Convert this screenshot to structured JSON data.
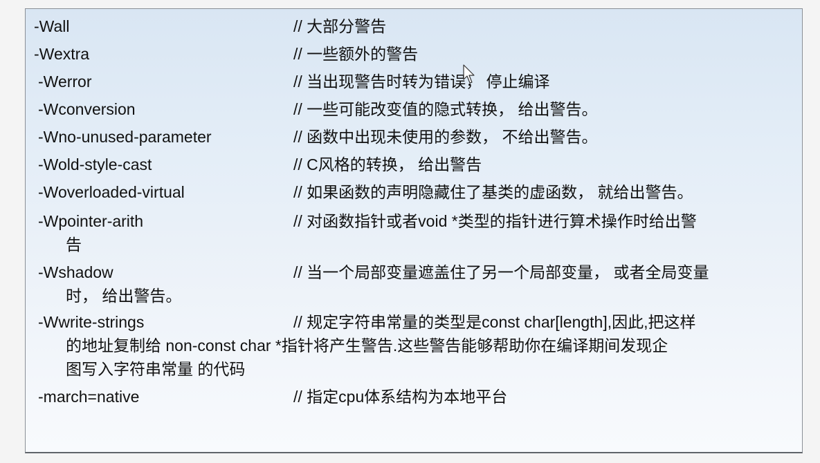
{
  "entries": [
    {
      "flag": "-Wall",
      "desc": "// 大部分警告"
    },
    {
      "flag": "-Wextra",
      "desc": "// 一些额外的警告"
    },
    {
      "flag": "-Werror",
      "desc": "// 当出现警告时转为错误， 停止编译"
    },
    {
      "flag": "-Wconversion",
      "desc": "// 一些可能改变值的隐式转换， 给出警告。"
    },
    {
      "flag": "-Wno-unused-parameter",
      "desc": "// 函数中出现未使用的参数， 不给出警告。"
    },
    {
      "flag": "-Wold-style-cast",
      "desc": "// C风格的转换， 给出警告"
    },
    {
      "flag": "-Woverloaded-virtual",
      "desc": "// 如果函数的声明隐藏住了基类的虚函数， 就给出警告。"
    },
    {
      "flag": "-Wpointer-arith",
      "desc": "// 对函数指针或者void *类型的指针进行算术操作时给出警",
      "cont": "告"
    },
    {
      "flag": "-Wshadow",
      "desc": "// 当一个局部变量遮盖住了另一个局部变量， 或者全局变量",
      "cont": "时， 给出警告。"
    },
    {
      "flag": "-Wwrite-strings",
      "desc": "// 规定字符串常量的类型是const char[length],因此,把这样",
      "cont": "的地址复制给 non-const char *指针将产生警告.这些警告能够帮助你在编译期间发现企",
      "cont2": "图写入字符串常量 的代码"
    },
    {
      "flag": "-march=native",
      "desc": "// 指定cpu体系结构为本地平台"
    }
  ]
}
